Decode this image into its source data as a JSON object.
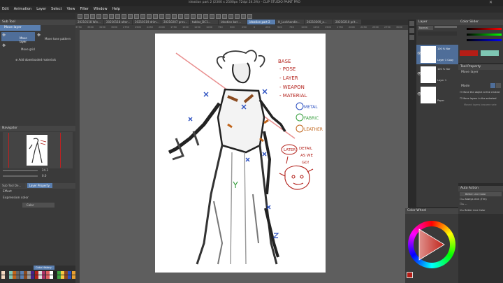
{
  "app": {
    "title": "ideation part 2 (2300 x 2500px 72dpi 24.3%) - CLIP STUDIO PAINT PRO"
  },
  "menu": [
    "Edit",
    "Animation",
    "Layer",
    "Select",
    "View",
    "Filter",
    "Window",
    "Help"
  ],
  "tabs": [
    {
      "label": "20210118 Win..."
    },
    {
      "label": "20210118 alter..."
    },
    {
      "label": "20210119 drim..."
    },
    {
      "label": "20210207 prev..."
    },
    {
      "label": "tablez_DC1..."
    },
    {
      "label": "ideation bat ..."
    },
    {
      "label": "ideation part 2"
    },
    {
      "label": "H_Lockhandle..."
    },
    {
      "label": "20210209_a..."
    },
    {
      "label": "20210210 prit..."
    }
  ],
  "ruler": [
    "3750",
    "3500",
    "3250",
    "3000",
    "2750",
    "2500",
    "2250",
    "2000",
    "1750",
    "1500",
    "1250",
    "1000",
    "750",
    "500",
    "250",
    "0",
    "250",
    "500",
    "750",
    "1000",
    "1250",
    "1500",
    "1750",
    "2000",
    "2250",
    "2500",
    "2750",
    "3000"
  ],
  "tool_panel": {
    "header": "Sub Tool",
    "group": "Move layer",
    "tools": [
      "Move layer",
      "Move tone pattern",
      "Move grid"
    ],
    "add_materials": "Add downloaded materials"
  },
  "navigator": {
    "header": "Navigator",
    "zoom": "24.3",
    "angle": "0.0"
  },
  "tool_property": {
    "tabs": [
      "Sub Tool De...",
      "Layer Property"
    ],
    "effect_label": "Effect",
    "expression_label": "Expression color",
    "expression_value": "Color"
  },
  "color_history": {
    "header": "Color History"
  },
  "layers": {
    "header": "Layer",
    "blend_mode": "Normal",
    "items": [
      {
        "name": "Layer 1 Copy",
        "opacity": "100 % Nor"
      },
      {
        "name": "Layer 1",
        "opacity": "100 % Nor"
      },
      {
        "name": "Paper",
        "opacity": ""
      }
    ]
  },
  "color_slider": {
    "header": "Color Slider",
    "main_color": "#b51d16",
    "sub_color": "#7fc7b4"
  },
  "tool_property_right": {
    "header": "Tool Property",
    "title": "Move layer",
    "mode_label": "Mode",
    "options": [
      "Move the object at the clicked",
      "Move layers in the selected",
      "Moved layers become sele"
    ]
  },
  "auto_action": {
    "header": "Auto Action",
    "selected": "Better Line Color",
    "items": [
      "Always click (Tim)",
      "...",
      "Better Line Color"
    ]
  },
  "color_wheel": {
    "header": "Color Wheel"
  },
  "canvas_notes": {
    "list": [
      "BASE",
      "- POSE",
      "- LAYER",
      "- WEAPON",
      "- MATERIAL"
    ],
    "materials": [
      "METAL",
      "FABRIC",
      "LEATHER"
    ],
    "later": "LATER",
    "detail": [
      "DETAIL",
      "AS WE",
      "GO!"
    ]
  },
  "colors": {
    "accent": "#5a7fb0",
    "note_red": "#b3201a",
    "metal_blue": "#2a4fc0",
    "fabric_green": "#3aa040",
    "leather_orange": "#c0641a"
  }
}
